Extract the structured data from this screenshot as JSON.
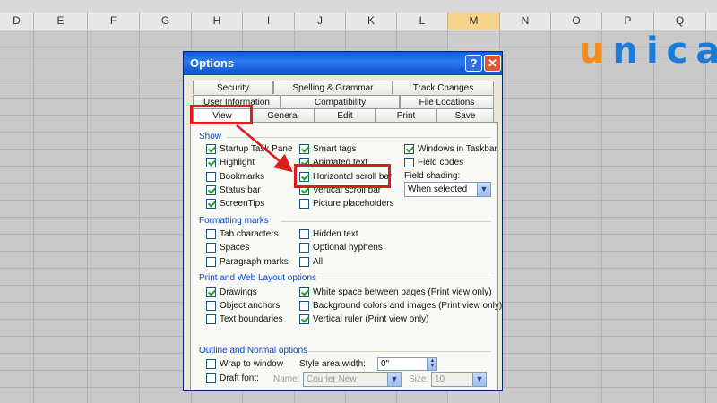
{
  "sheet": {
    "columns": [
      "D",
      "E",
      "F",
      "G",
      "H",
      "I",
      "J",
      "K",
      "L",
      "M",
      "N",
      "O",
      "P",
      "Q"
    ],
    "active_column": "M"
  },
  "logo": {
    "text_u": "u",
    "text_rest": "nica"
  },
  "dialog": {
    "title": "Options",
    "help_label": "?",
    "close_label": "✕",
    "tabs_row1": [
      "Security",
      "Spelling & Grammar",
      "Track Changes"
    ],
    "tabs_row2": [
      "User Information",
      "Compatibility",
      "File Locations"
    ],
    "tabs_row3": [
      "View",
      "General",
      "Edit",
      "Print",
      "Save"
    ],
    "selected_tab": "View",
    "show": {
      "heading": "Show",
      "col1": [
        {
          "label": "Startup Task Pane",
          "checked": true
        },
        {
          "label": "Highlight",
          "checked": true
        },
        {
          "label": "Bookmarks",
          "checked": false
        },
        {
          "label": "Status bar",
          "checked": true
        },
        {
          "label": "ScreenTips",
          "checked": true
        }
      ],
      "col2": [
        {
          "label": "Smart tags",
          "checked": true
        },
        {
          "label": "Animated text",
          "checked": true
        },
        {
          "label": "Horizontal scroll bar",
          "checked": true
        },
        {
          "label": "Vertical scroll bar",
          "checked": true
        },
        {
          "label": "Picture placeholders",
          "checked": false
        }
      ],
      "col3": [
        {
          "label": "Windows in Taskbar",
          "checked": true
        },
        {
          "label": "Field codes",
          "checked": false
        }
      ],
      "field_shading_label": "Field shading:",
      "field_shading_value": "When selected"
    },
    "formatting": {
      "heading": "Formatting marks",
      "col1": [
        {
          "label": "Tab characters",
          "checked": false
        },
        {
          "label": "Spaces",
          "checked": false
        },
        {
          "label": "Paragraph marks",
          "checked": false
        }
      ],
      "col2": [
        {
          "label": "Hidden text",
          "checked": false
        },
        {
          "label": "Optional hyphens",
          "checked": false
        },
        {
          "label": "All",
          "checked": false
        }
      ]
    },
    "print_web": {
      "heading": "Print and Web Layout options",
      "col1": [
        {
          "label": "Drawings",
          "checked": true
        },
        {
          "label": "Object anchors",
          "checked": false
        },
        {
          "label": "Text boundaries",
          "checked": false
        }
      ],
      "col2": [
        {
          "label": "White space between pages (Print view only)",
          "checked": true
        },
        {
          "label": "Background colors and images (Print view only)",
          "checked": false
        },
        {
          "label": "Vertical ruler (Print view only)",
          "checked": true
        }
      ]
    },
    "outline": {
      "heading": "Outline and Normal options",
      "wrap_label": "Wrap to window",
      "draft_label": "Draft font:",
      "style_area_label": "Style area width:",
      "style_area_value": "0\"",
      "name_label": "Name:",
      "name_value": "Courier New",
      "size_label": "Size:",
      "size_value": "10"
    }
  },
  "colors": {
    "highlight": "#e01b1b",
    "accent": "#0046d5",
    "logo_blue": "#1b7bd6",
    "logo_orange": "#f28c1e"
  }
}
